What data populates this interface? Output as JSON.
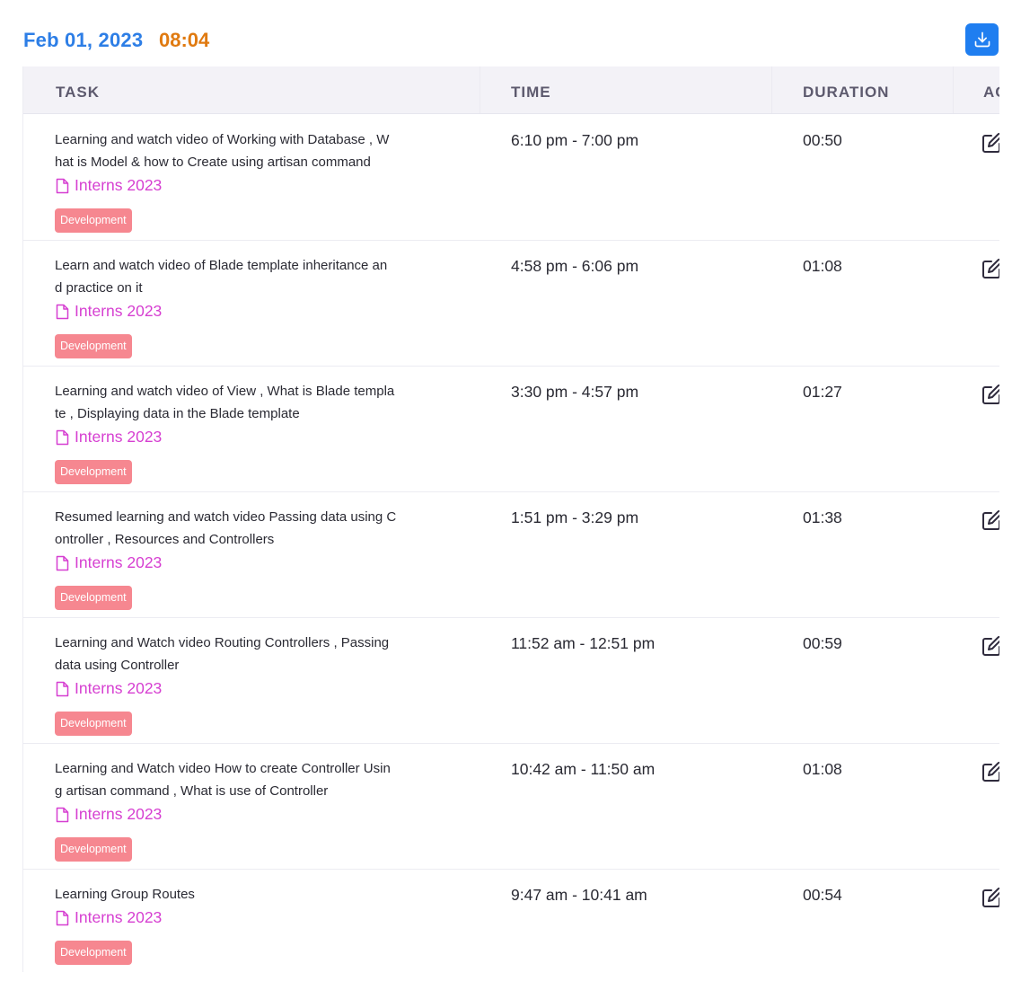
{
  "header": {
    "date": "Feb 01, 2023",
    "time": "08:04",
    "download_icon": "download-icon"
  },
  "table": {
    "columns": [
      "TASK",
      "TIME",
      "DURATION",
      "ACTIONS"
    ],
    "rows": [
      {
        "task_lines": [
          "Learning and watch video of Working with Database , W",
          "hat is Model & how to Create using artisan command"
        ],
        "project": "Interns 2023",
        "tag": "Development",
        "time": "6:10 pm - 7:00 pm",
        "duration": "00:50"
      },
      {
        "task_lines": [
          "Learn and watch video of Blade template inheritance an",
          "d practice on it"
        ],
        "project": "Interns 2023",
        "tag": "Development",
        "time": "4:58 pm - 6:06 pm",
        "duration": "01:08"
      },
      {
        "task_lines": [
          "Learning and watch video of View , What is Blade templa",
          "te , Displaying data in the Blade template"
        ],
        "project": "Interns 2023",
        "tag": "Development",
        "time": "3:30 pm - 4:57 pm",
        "duration": "01:27"
      },
      {
        "task_lines": [
          "Resumed learning and watch video Passing data using C",
          "ontroller , Resources and Controllers"
        ],
        "project": "Interns 2023",
        "tag": "Development",
        "time": "1:51 pm - 3:29 pm",
        "duration": "01:38"
      },
      {
        "task_lines": [
          "Learning and Watch video Routing Controllers , Passing",
          "data using Controller"
        ],
        "project": "Interns 2023",
        "tag": "Development",
        "time": "11:52 am - 12:51 pm",
        "duration": "00:59"
      },
      {
        "task_lines": [
          "Learning and Watch video How to create Controller Usin",
          "g artisan command , What is use of Controller"
        ],
        "project": "Interns 2023",
        "tag": "Development",
        "time": "10:42 am - 11:50 am",
        "duration": "01:08"
      },
      {
        "task_lines": [
          "Learning Group Routes"
        ],
        "project": "Interns 2023",
        "tag": "Development",
        "time": "9:47 am - 10:41 am",
        "duration": "00:54"
      }
    ]
  },
  "colors": {
    "date": "#2d7ee6",
    "time": "#e07a10",
    "project": "#d63fd1",
    "tag_bg": "#f68790",
    "download_bg": "#1f7ef0"
  }
}
